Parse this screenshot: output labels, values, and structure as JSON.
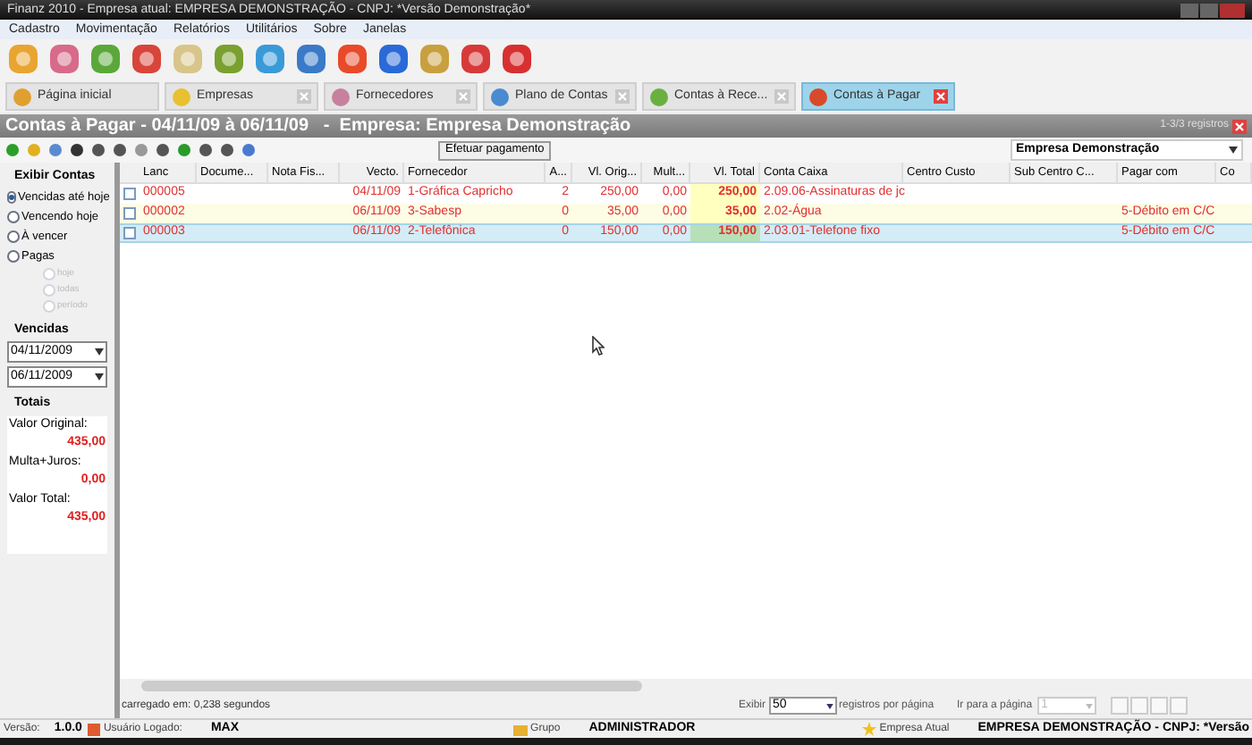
{
  "window": {
    "title": "Finanz 2010 - Empresa atual: EMPRESA DEMONSTRAÇÃO - CNPJ:  *Versão Demonstração*"
  },
  "menu": [
    "Cadastro",
    "Movimentação",
    "Relatórios",
    "Utilitários",
    "Sobre",
    "Janelas"
  ],
  "tabs": [
    {
      "label": "Página inicial",
      "selected": false,
      "closable": false
    },
    {
      "label": "Empresas",
      "selected": false,
      "closable": true
    },
    {
      "label": "Fornecedores",
      "selected": false,
      "closable": true
    },
    {
      "label": "Plano de Contas",
      "selected": false,
      "closable": true
    },
    {
      "label": "Contas à Rece...",
      "selected": false,
      "closable": true
    },
    {
      "label": "Contas à Pagar",
      "selected": true,
      "closable": true
    }
  ],
  "header": {
    "title": "Contas à Pagar - 04/11/09 à 06/11/09   -  Empresa: Empresa Demonstração",
    "count": "1-3/3 registros"
  },
  "action_button": "Efetuar pagamento",
  "company_select": "Empresa Demonstração",
  "sidebar": {
    "title": "Exibir Contas",
    "options": [
      {
        "label": "Vencidas até hoje",
        "selected": true
      },
      {
        "label": "Vencendo hoje",
        "selected": false
      },
      {
        "label": "À vencer",
        "selected": false
      },
      {
        "label": "Pagas",
        "selected": false
      }
    ],
    "sub_options": [
      {
        "label": "hoje",
        "selected": false
      },
      {
        "label": "todas",
        "selected": false
      },
      {
        "label": "período",
        "selected": false
      }
    ],
    "dates_title": "Vencidas",
    "date_from": "04/11/2009",
    "date_to": "06/11/2009",
    "totals_title": "Totais",
    "totals": [
      {
        "label": "Valor Original:",
        "value": "435,00"
      },
      {
        "label": "Multa+Juros:",
        "value": "0,00"
      },
      {
        "label": "Valor Total:",
        "value": "435,00"
      }
    ]
  },
  "table": {
    "columns": [
      "Lanc",
      "Docume...",
      "Nota Fis...",
      "Vecto.",
      "Fornecedor",
      "A...",
      "Vl. Orig...",
      "Mult...",
      "Vl. Total",
      "Conta Caixa",
      "Centro Custo",
      "Sub Centro C...",
      "Pagar com",
      "Co"
    ],
    "rows": [
      {
        "selected": false,
        "lanc": "000005",
        "vecto": "04/11/09",
        "fornecedor": "1-Gráfica Capricho",
        "column_6": "2",
        "vl_orig": "250,00",
        "mult": "0,00",
        "vl_total": "250,00",
        "conta_caixa": "2.09.06-Assinaturas de jc"
      },
      {
        "selected": false,
        "lanc": "000002",
        "vecto": "06/11/09",
        "fornecedor": "3-Sabesp",
        "column_6": "0",
        "vl_orig": "35,00",
        "mult": "0,00",
        "vl_total": "35,00",
        "conta_caixa": "2.02-Água",
        "pagar_com": "5-Débito em C/C"
      },
      {
        "selected": true,
        "lanc": "000003",
        "vecto": "06/11/09",
        "fornecedor": "2-Telefônica",
        "column_6": "0",
        "vl_orig": "150,00",
        "mult": "0,00",
        "vl_total": "150,00",
        "conta_caixa": "2.03.01-Telefone fixo",
        "pagar_com": "5-Débito em C/C"
      }
    ]
  },
  "load_time": "carregado em: 0,238 segundos",
  "pager": {
    "show_label": "Exibir",
    "per_page": "50",
    "per_page_label": "registros por página",
    "goto_label": "Ir para a página",
    "page": "1"
  },
  "status_bar": [
    {
      "label": "Versão:",
      "value": "1.0.0"
    },
    {
      "label": "Usuário Logado:",
      "value": "MAX",
      "kind": "user"
    },
    {
      "label": "Grupo",
      "value": "ADMINISTRADOR",
      "kind": "group"
    },
    {
      "label": "Empresa Atual",
      "value": "EMPRESA DEMONSTRAÇÃO - CNPJ:  *Versão",
      "kind": "company"
    }
  ]
}
